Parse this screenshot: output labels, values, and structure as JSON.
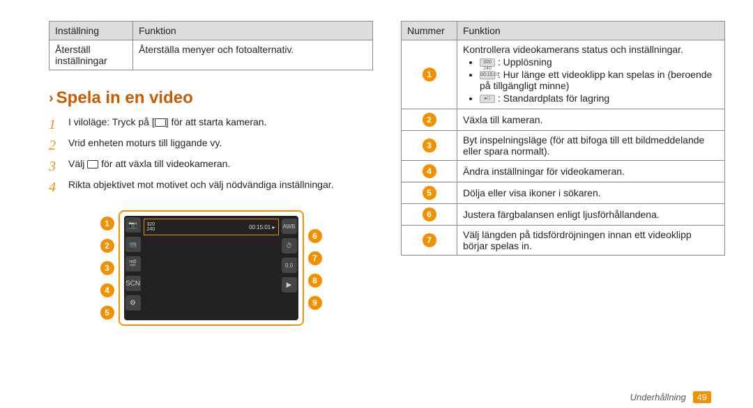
{
  "left_table": {
    "headers": [
      "Inställning",
      "Funktion"
    ],
    "rows": [
      {
        "c0": "Återställ\ninställningar",
        "c1": "Återställa menyer och fotoalternativ."
      }
    ]
  },
  "section": {
    "chevron": "›",
    "title": "Spela in en video"
  },
  "steps": [
    {
      "n": "1",
      "text_before": "I viloläge: Tryck på [",
      "text_after": "] för att starta kameran."
    },
    {
      "n": "2",
      "text": "Vrid enheten moturs till liggande vy."
    },
    {
      "n": "3",
      "text_before": "Välj ",
      "text_after": " för att växla till videokameran."
    },
    {
      "n": "4",
      "text": "Rikta objektivet mot motivet och välj nödvändiga inställningar."
    }
  ],
  "screen": {
    "topbar_left": "320\n240",
    "topbar_right": "00:15:01 ▸",
    "left_icons": [
      "📷",
      "📹",
      "🎬",
      "SCN",
      "⚙"
    ],
    "right_icons": [
      "AWB",
      "⏱",
      "0.0",
      "▶"
    ]
  },
  "left_callouts": [
    "1",
    "2",
    "3",
    "4",
    "5"
  ],
  "right_callouts": [
    "6",
    "7",
    "8",
    "9"
  ],
  "right_table": {
    "headers": [
      "Nummer",
      "Funktion"
    ],
    "rows": [
      {
        "num": "1",
        "intro": "Kontrollera videokamerans status och inställningar.",
        "bullets": [
          {
            "icon": "320 240",
            "text": ": Upplösning"
          },
          {
            "icon": "00:15:01",
            "text": ": Hur länge ett videoklipp kan spelas in (beroende på tillgängligt minne)"
          },
          {
            "icon": "▸□",
            "text": ": Standardplats för lagring"
          }
        ]
      },
      {
        "num": "2",
        "text": "Växla till kameran."
      },
      {
        "num": "3",
        "text": "Byt inspelningsläge (för att bifoga till ett bildmeddelande eller spara normalt)."
      },
      {
        "num": "4",
        "text": "Ändra inställningar för videokameran."
      },
      {
        "num": "5",
        "text": "Dölja eller visa ikoner i sökaren."
      },
      {
        "num": "6",
        "text": "Justera färgbalansen enligt ljusförhållandena."
      },
      {
        "num": "7",
        "text": "Välj längden på tidsfördröjningen innan ett videoklipp börjar spelas in."
      }
    ]
  },
  "footer": {
    "label": "Underhållning",
    "page": "49"
  }
}
